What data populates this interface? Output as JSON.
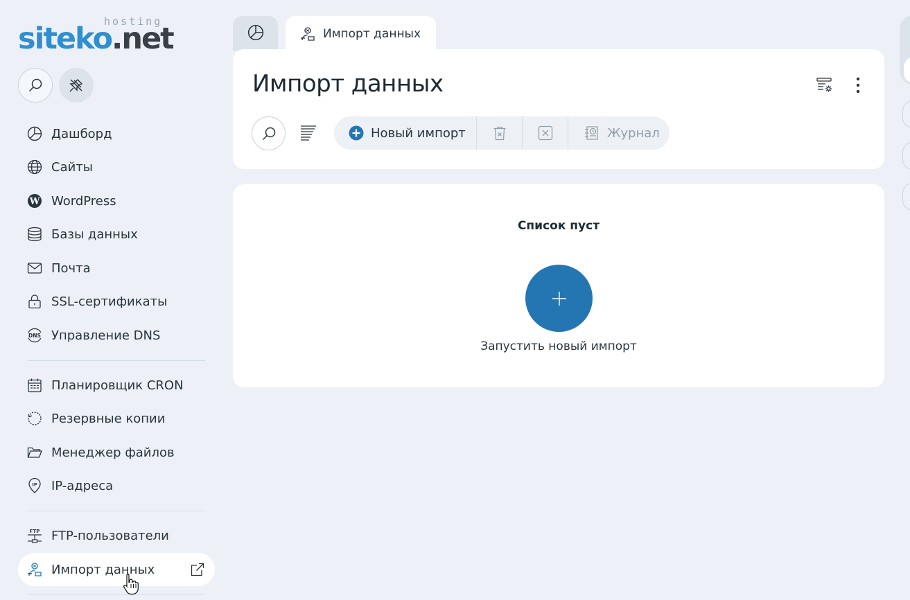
{
  "brand": {
    "hosting": "hosting",
    "name_a": "siteko",
    "name_b": ".net"
  },
  "sidebar": {
    "items": [
      {
        "label": "Дашборд",
        "icon": "dashboard-pie-icon"
      },
      {
        "label": "Сайты",
        "icon": "globe-icon"
      },
      {
        "label": "WordPress",
        "icon": "wordpress-icon"
      },
      {
        "label": "Базы данных",
        "icon": "database-icon"
      },
      {
        "label": "Почта",
        "icon": "mail-icon"
      },
      {
        "label": "SSL-сертификаты",
        "icon": "lock-icon"
      },
      {
        "label": "Управление DNS",
        "icon": "dns-icon"
      },
      {
        "label": "Планировщик CRON",
        "icon": "calendar-icon"
      },
      {
        "label": "Резервные копии",
        "icon": "backup-icon"
      },
      {
        "label": "Менеджер файлов",
        "icon": "folder-icon"
      },
      {
        "label": "IP-адреса",
        "icon": "ip-pin-icon"
      },
      {
        "label": "FTP-пользователи",
        "icon": "ftp-icon"
      },
      {
        "label": "Импорт данных",
        "icon": "import-user-icon",
        "active": true
      }
    ]
  },
  "tabs": {
    "active_label": "Импорт данных"
  },
  "header": {
    "title": "Импорт данных"
  },
  "toolbar": {
    "new_import": "Новый импорт",
    "log": "Журнал"
  },
  "empty_state": {
    "title": "Список пуст",
    "action": "Запустить новый импорт"
  },
  "colors": {
    "accent": "#2476b3",
    "brand_blue": "#2f8fd0",
    "background": "#edf1f7"
  }
}
